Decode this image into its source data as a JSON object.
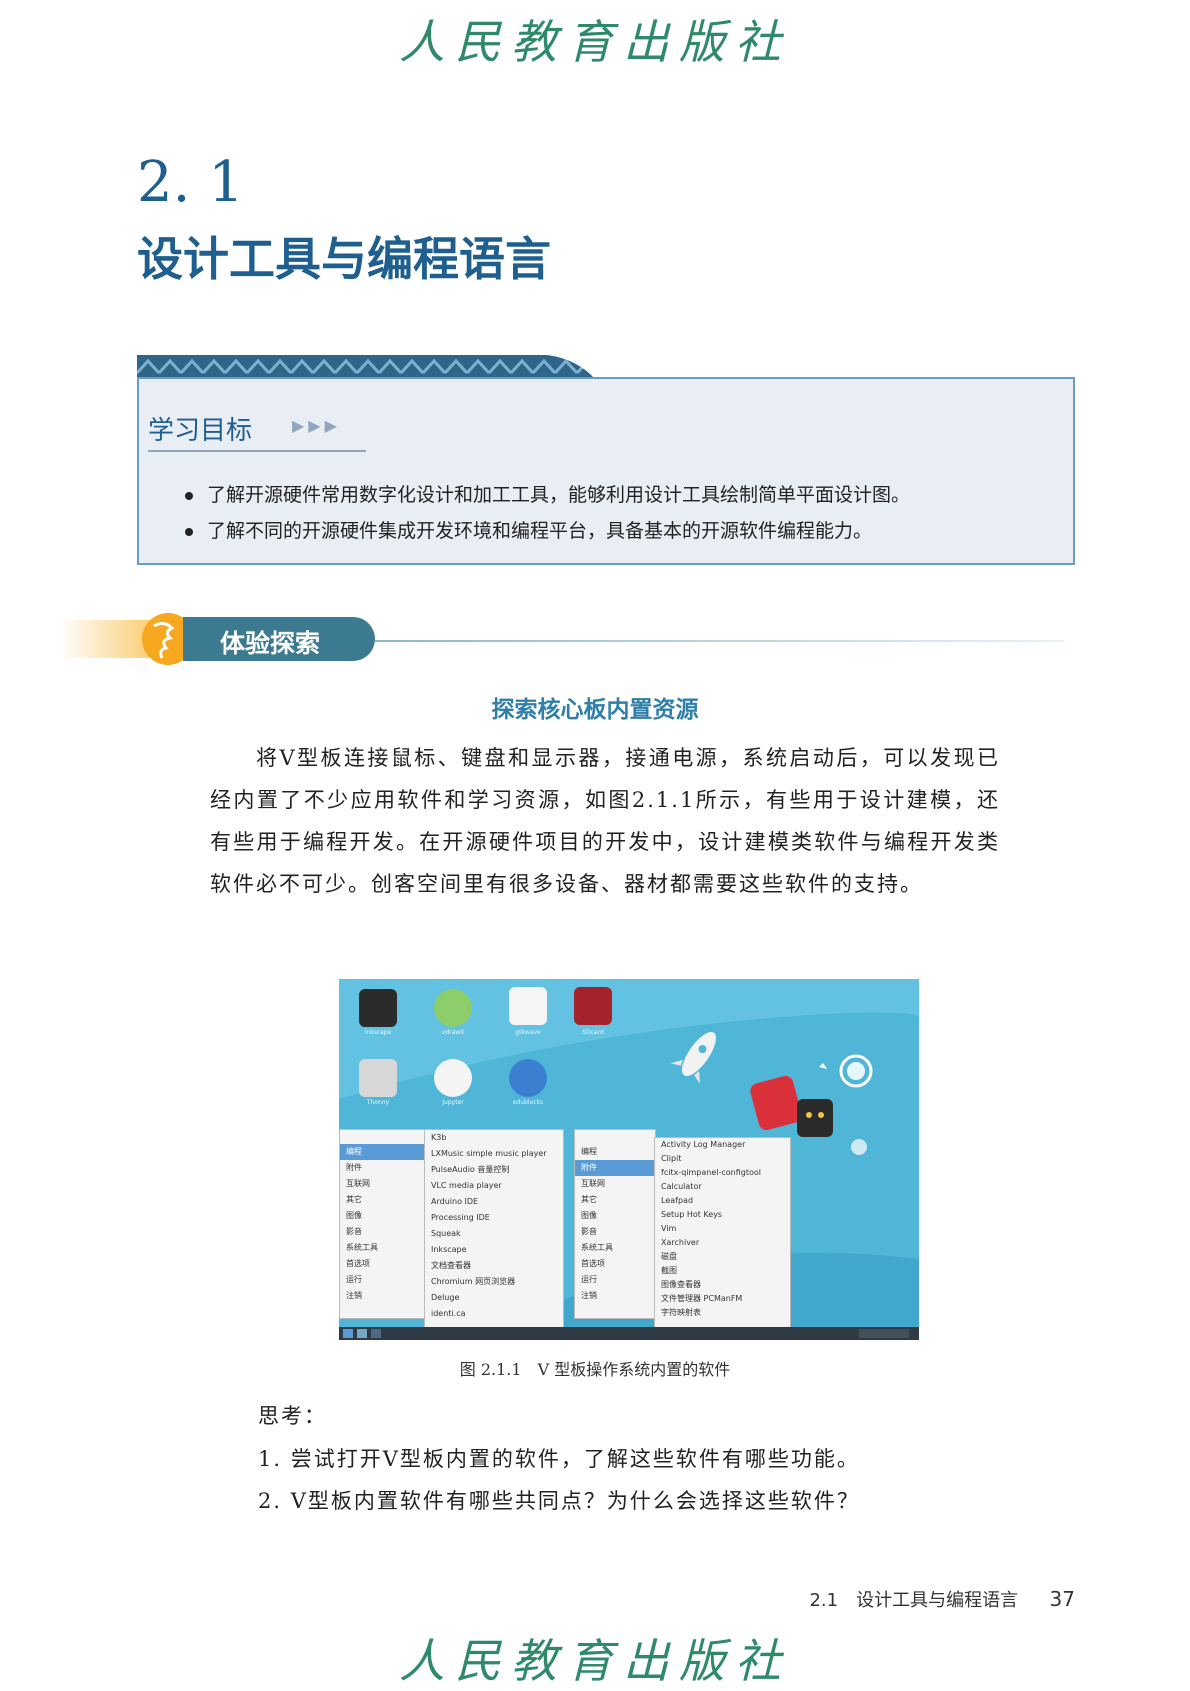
{
  "header": {
    "publisher": "人民教育出版社"
  },
  "section": {
    "number": "2. 1",
    "title": "设计工具与编程语言"
  },
  "goals": {
    "heading": "学习目标",
    "arrows": "▶▶▶",
    "items": [
      "了解开源硬件常用数字化设计和加工工具，能够利用设计工具绘制简单平面设计图。",
      "了解不同的开源硬件集成开发环境和编程平台，具备基本的开源软件编程能力。"
    ]
  },
  "explore": {
    "label": "体验探索",
    "subtitle": "探索核心板内置资源",
    "paragraph": "将V型板连接鼠标、键盘和显示器，接通电源，系统启动后，可以发现已经内置了不少应用软件和学习资源，如图2.1.1所示，有些用于设计建模，还有些用于编程开发。在开源硬件项目的开发中，设计建模类软件与编程开发类软件必不可少。创客空间里有很多设备、器材都需要这些软件的支持。"
  },
  "figure": {
    "caption": "图 2.1.1　V 型板操作系统内置的软件",
    "desktop_icons": [
      "Inkscape",
      "vdrawit",
      "gtkwave",
      "SDcard",
      "Thonny",
      "Jupyter",
      "edublocks"
    ],
    "menu_left": [
      "编程",
      "附件",
      "互联网",
      "其它",
      "图像",
      "影音",
      "系统工具",
      "首选项",
      "运行",
      "注销"
    ],
    "submenu_program": [
      "K3b",
      "LXMusic simple music player",
      "PulseAudio 音量控制",
      "VLC media player",
      "Arduino IDE",
      "Processing IDE",
      "Squeak",
      "Inkscape",
      "文档查看器",
      "Chromium 网页浏览器",
      "Deluge",
      "identi.ca"
    ],
    "menu_right": [
      "编程",
      "附件",
      "互联网",
      "其它",
      "图像",
      "影音",
      "系统工具",
      "首选项",
      "运行",
      "注销"
    ],
    "submenu_accessories": [
      "Activity Log Manager",
      "Clipit",
      "fcitx-qimpanel-configtool",
      "Calculator",
      "Leafpad",
      "Setup Hot Keys",
      "Vim",
      "Xarchiver",
      "磁盘",
      "截图",
      "图像查看器",
      "文件管理器 PCManFM",
      "字符映射表"
    ]
  },
  "think": {
    "heading": "思考：",
    "questions": [
      "1. 尝试打开V型板内置的软件，了解这些软件有哪些功能。",
      "2. V型板内置软件有哪些共同点？为什么会选择这些软件？"
    ]
  },
  "footer": {
    "section": "2.1　设计工具与编程语言",
    "page": "37"
  }
}
